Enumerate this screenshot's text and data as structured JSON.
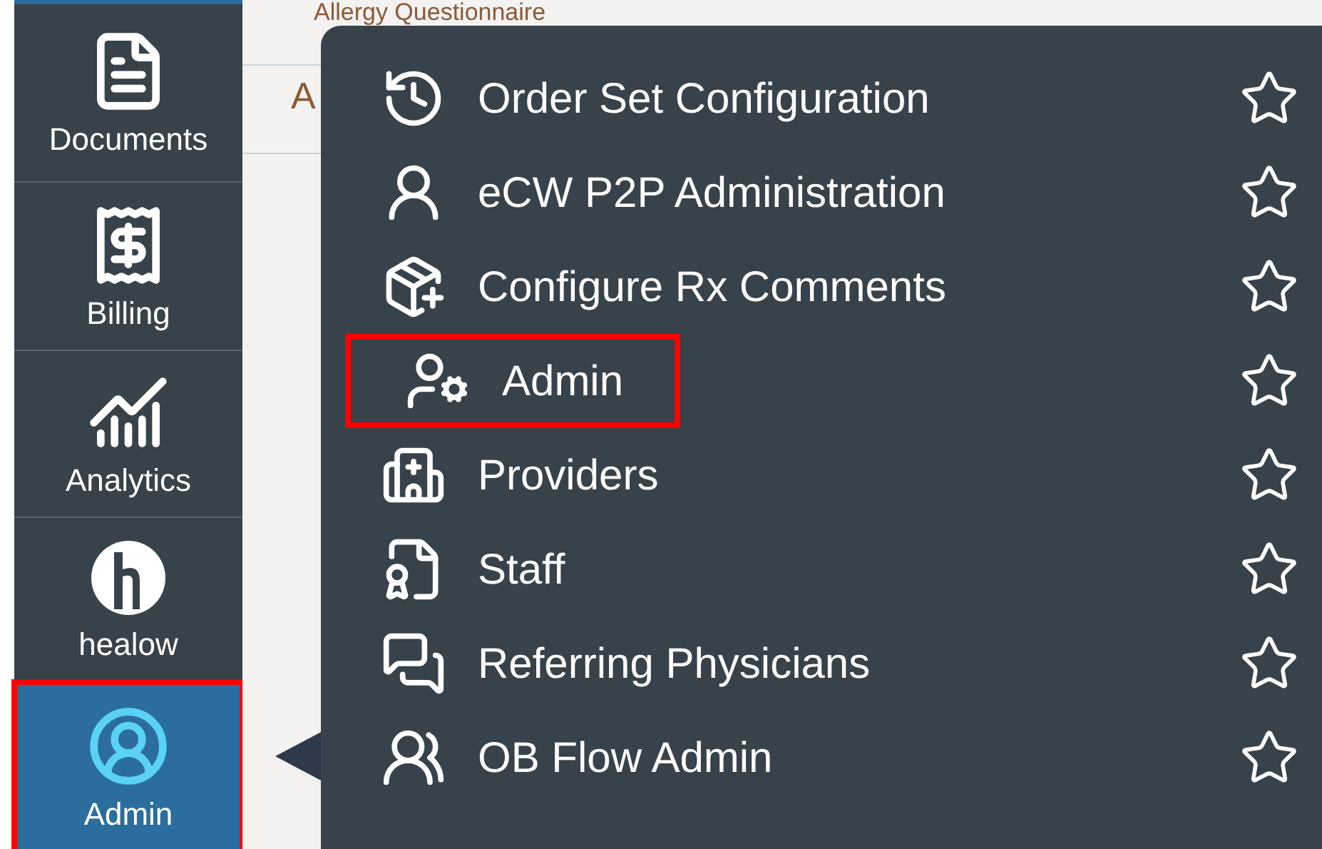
{
  "sidebar": {
    "items": [
      {
        "label": "Documents",
        "selected": false
      },
      {
        "label": "Billing",
        "selected": false
      },
      {
        "label": "Analytics",
        "selected": false
      },
      {
        "label": "healow",
        "selected": false
      },
      {
        "label": "Admin",
        "selected": true,
        "highlighted": true
      }
    ]
  },
  "background_list": {
    "rows": [
      "Allergy Questionnaire",
      "A"
    ]
  },
  "menu": {
    "items": [
      {
        "label": "Order Set Configuration",
        "starred": false,
        "highlighted": false
      },
      {
        "label": "eCW P2P Administration",
        "starred": false,
        "highlighted": false
      },
      {
        "label": "Configure Rx Comments",
        "starred": false,
        "highlighted": false
      },
      {
        "label": "Admin",
        "starred": false,
        "highlighted": true
      },
      {
        "label": "Providers",
        "starred": false,
        "highlighted": false
      },
      {
        "label": "Staff",
        "starred": false,
        "highlighted": false
      },
      {
        "label": "Referring Physicians",
        "starred": false,
        "highlighted": false
      },
      {
        "label": "OB Flow Admin",
        "starred": false,
        "highlighted": false
      }
    ]
  }
}
